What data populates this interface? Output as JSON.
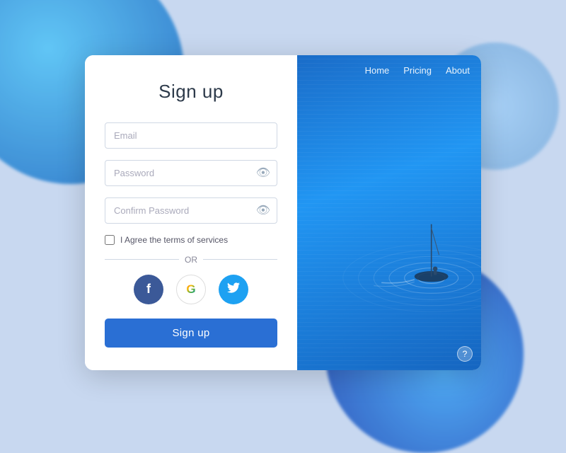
{
  "background": {
    "color": "#c8d8f0"
  },
  "card": {
    "title": "Sign up",
    "form": {
      "email_placeholder": "Email",
      "password_placeholder": "Password",
      "confirm_password_placeholder": "Confirm Password",
      "terms_label": "I Agree the terms of services",
      "or_text": "OR",
      "signup_button_label": "Sign up"
    },
    "social": {
      "facebook_label": "f",
      "google_label": "G",
      "twitter_label": "🐦"
    },
    "nav": {
      "home_label": "Home",
      "pricing_label": "Pricing",
      "about_label": "About"
    },
    "help_label": "?"
  }
}
